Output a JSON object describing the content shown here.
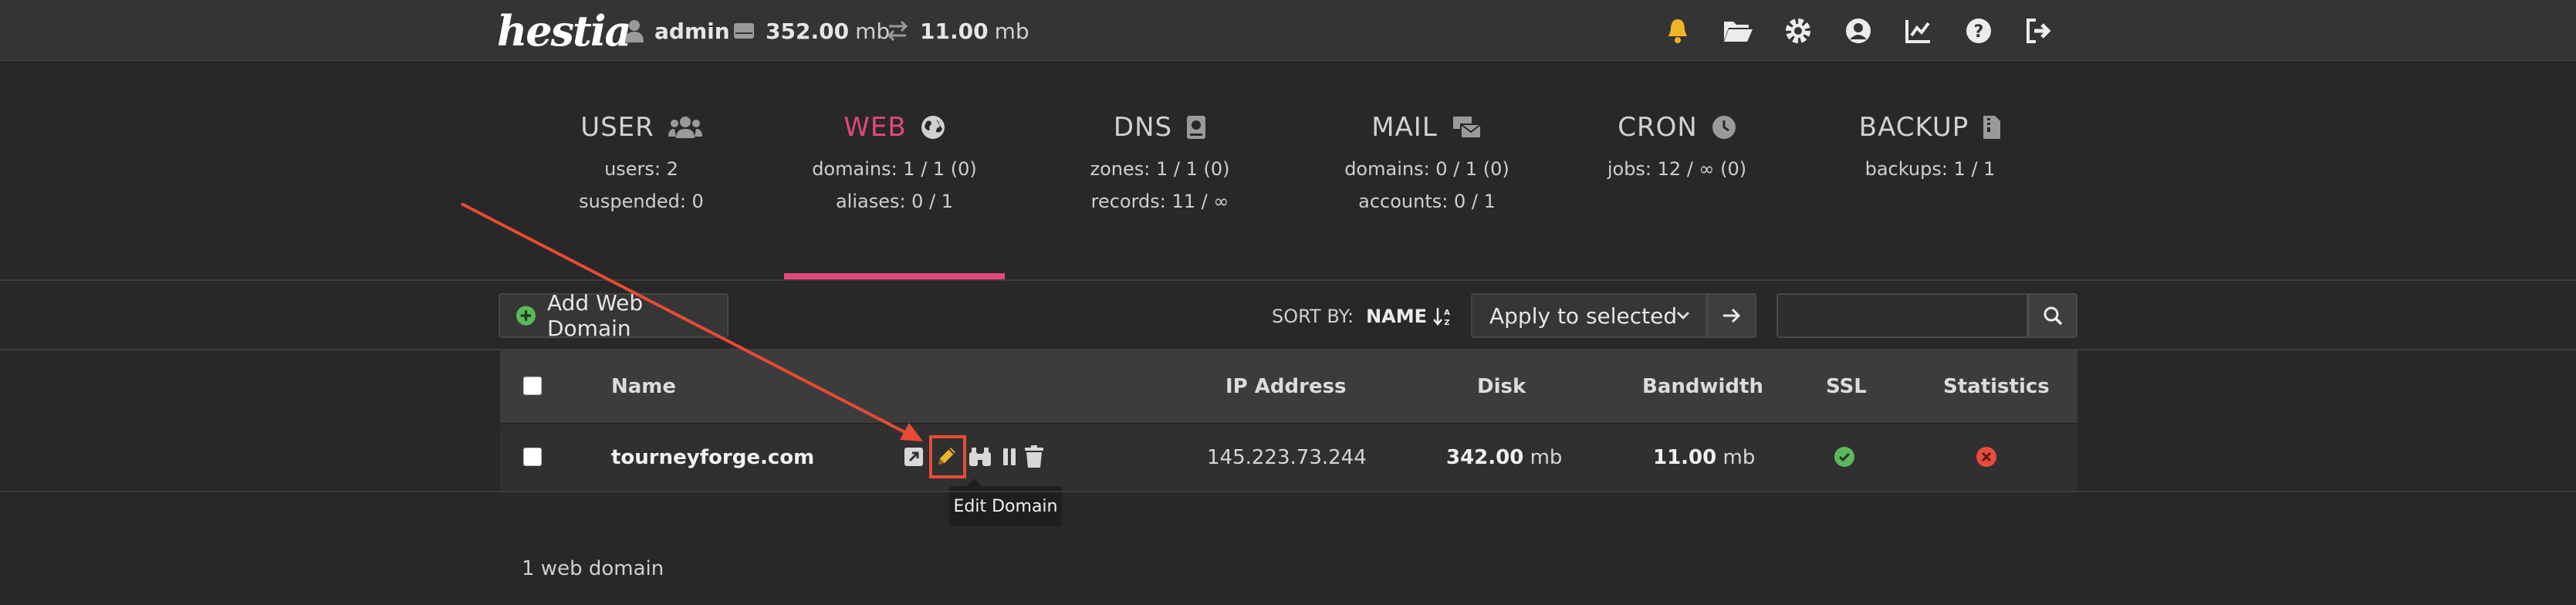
{
  "topbar": {
    "logo_main": "hestia",
    "user": "admin",
    "disk_value": "352.00",
    "disk_unit": "mb",
    "bandwidth_value": "11.00",
    "bandwidth_unit": "mb",
    "icons": [
      "bell-icon",
      "folder-icon",
      "gear-icon",
      "user-circle-icon",
      "chart-line-icon",
      "help-icon",
      "logout-icon"
    ],
    "bell_color": "#f0b429"
  },
  "tabs": [
    {
      "title": "USER",
      "lines": [
        "users: 2",
        "suspended: 0"
      ],
      "icon": "users-icon"
    },
    {
      "title": "WEB",
      "lines": [
        "domains: 1 / 1 (0)",
        "aliases: 0 / 1"
      ],
      "icon": "globe-icon",
      "active": true
    },
    {
      "title": "DNS",
      "lines": [
        "zones: 1 / 1 (0)",
        "records: 11 / ∞"
      ],
      "icon": "book-icon"
    },
    {
      "title": "MAIL",
      "lines": [
        "domains: 0 / 1 (0)",
        "accounts: 0 / 1"
      ],
      "icon": "mail-bulk-icon"
    },
    {
      "title": "CRON",
      "lines": [
        "jobs: 12 / ∞ (0)"
      ],
      "icon": "clock-icon"
    },
    {
      "title": "BACKUP",
      "lines": [
        "backups: 1 / 1"
      ],
      "icon": "file-zip-icon"
    }
  ],
  "accent_color": "#e2487a",
  "toolbar": {
    "add_label": "Add Web Domain",
    "sort_prefix": "SORT BY:",
    "sort_field": "NAME",
    "apply_label": "Apply to selected",
    "search_placeholder": ""
  },
  "table": {
    "headers": {
      "name": "Name",
      "ip": "IP Address",
      "disk": "Disk",
      "bandwidth": "Bandwidth",
      "ssl": "SSL",
      "stats": "Statistics"
    },
    "rows": [
      {
        "domain": "tourneyforge.com",
        "ip": "145.223.73.244",
        "disk_value": "342.00",
        "disk_unit": "mb",
        "bw_value": "11.00",
        "bw_unit": "mb",
        "ssl": "enabled",
        "statistics": "disabled"
      }
    ]
  },
  "tooltip": "Edit Domain",
  "footer": "1 web domain",
  "colors": {
    "ok": "#5cb85c",
    "error": "#e74c3c",
    "annotation": "#e84a36"
  }
}
